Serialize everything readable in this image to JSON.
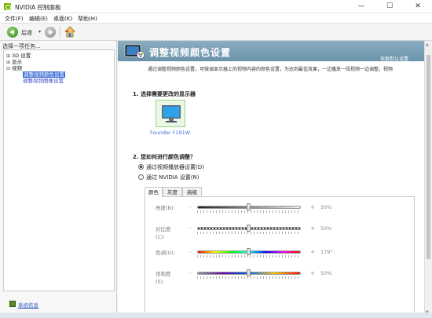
{
  "window": {
    "title": "NVIDIA 控制面板",
    "min_symbol": "—",
    "max_symbol": "☐",
    "close_symbol": "✕"
  },
  "menu": [
    "文件(F)",
    "编辑(E)",
    "桌面(K)",
    "帮助(H)"
  ],
  "toolbar": {
    "back_label": "后退",
    "dropdown_symbol": "▾"
  },
  "sidebar": {
    "header": "选择一项任务...",
    "tree": [
      {
        "expander": "⊞",
        "label": "3D 设置",
        "level": 0
      },
      {
        "expander": "⊞",
        "label": "显示",
        "level": 0
      },
      {
        "expander": "⊟",
        "label": "视频",
        "level": 0
      },
      {
        "expander": "",
        "label": "调整视频颜色设置",
        "level": 1,
        "selected": true
      },
      {
        "expander": "",
        "label": "调整视频图像设置",
        "level": 1,
        "selected": false
      }
    ],
    "footer_link": "系统信息"
  },
  "main": {
    "title": "调整视频颜色设置",
    "restore_defaults": "恢复默认设置",
    "description": "通过调整视频颜色设置，可微调显示器上的视频内容的颜色设置，为达到最佳效果，一边播放一段视频一边调整，视频",
    "section1_title": "1. 选择需要更改的显示器",
    "display_name": "Founder F191W",
    "section2_title": "2. 您如何进行颜色调整？",
    "radio_options": [
      {
        "label": "通过视频播放器设置(D)",
        "checked": true
      },
      {
        "label": "通过 NVIDIA 设置(N)",
        "checked": false
      }
    ],
    "tabs": [
      "颜色",
      "灰度",
      "高级"
    ],
    "active_tab": 0,
    "sliders": [
      {
        "label": "亮度(B):",
        "value_text": "50%",
        "level": 0.5,
        "track": "gray"
      },
      {
        "label": "对比度\n(C):",
        "value_text": "50%",
        "level": 0.5,
        "track": "contrast"
      },
      {
        "label": "色调(U):",
        "value_text": "179°",
        "level": 0.5,
        "track": "hue"
      },
      {
        "label": "饱和度\n(S):",
        "value_text": "50%",
        "level": 0.5,
        "track": "sat"
      }
    ],
    "minus_symbol": "-",
    "plus_symbol": "+"
  },
  "colors": {
    "accent": "#76b900",
    "banner": "#7ba1b6",
    "link": "#2a54c4",
    "selection": "#3b6fd6"
  },
  "icons": [
    "nvidia-logo-icon",
    "back-arrow-icon",
    "forward-arrow-icon",
    "home-icon",
    "video-color-icon",
    "monitor-icon",
    "system-info-icon"
  ]
}
